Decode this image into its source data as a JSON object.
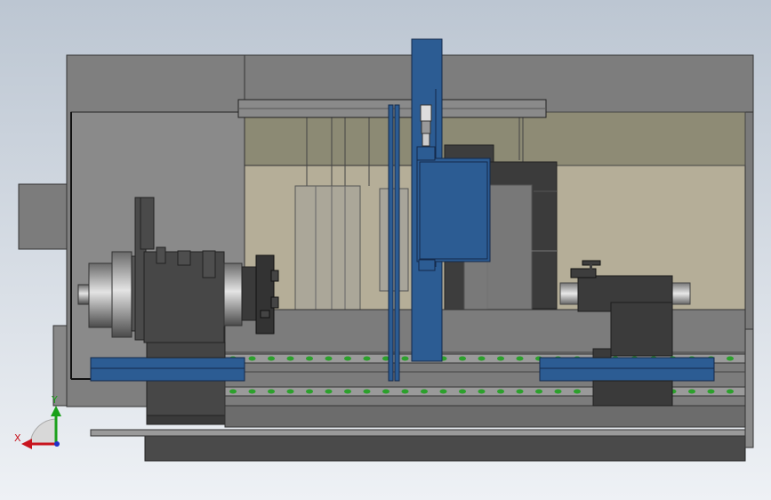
{
  "viewport": {
    "background_top": "#bcc6d2",
    "background_bottom": "#eef1f5"
  },
  "triad": {
    "x_label": "X",
    "y_label": "Y",
    "x_color": "#c8141e",
    "y_color": "#1aa01a",
    "z_color": "#2030c8"
  },
  "model": {
    "colors": {
      "enclosure": "#7d7d7d",
      "enclosure_dark": "#5e5e5e",
      "interior_back": "#b2ab96",
      "interior_upper": "#8d8a72",
      "machine_dark": "#3f3f3f",
      "steel_light": "#c9c9c9",
      "blue_part": "#2c5c93",
      "blue_dark": "#1d3f68",
      "green_marker": "#2ca02c"
    }
  }
}
